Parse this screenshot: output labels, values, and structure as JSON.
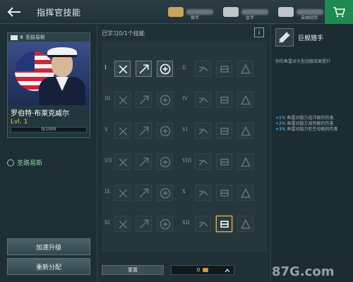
{
  "header": {
    "title": "指挥官技能",
    "currencies": [
      {
        "label": "银币",
        "color": "#c7a55a"
      },
      {
        "label": "金币",
        "color": "#c0c6c9"
      },
      {
        "label": "自由经验",
        "color": "#c0c6c9"
      }
    ]
  },
  "commander": {
    "nation_label": "圣路易斯",
    "name": "罗伯特·布莱克威尔",
    "level": "Lvl. 1",
    "xp_text": "0/1500",
    "xp_fraction": 0.0,
    "ship_name": "圣路易斯"
  },
  "left_buttons": {
    "speedup": "加速升级",
    "redistribute": "重新分配"
  },
  "skills_panel": {
    "learned_text": "已学习0/1个技能",
    "info_label": "i",
    "tiers": [
      "I",
      "II",
      "III",
      "IV",
      "V",
      "VI",
      "VII",
      "VIII",
      "IX",
      "X",
      "XI",
      "XII"
    ]
  },
  "bottom": {
    "reset_label": "重置",
    "points": "0"
  },
  "detail": {
    "title": "巨舰猎手",
    "description": "你的鱼雷对大型战舰效果提升",
    "bonuses": [
      {
        "pct": "+1%",
        "text": "鱼雷对敌方巡洋舰的伤害"
      },
      {
        "pct": "+2%",
        "text": "鱼雷对敌方战列舰的伤害"
      },
      {
        "pct": "+3%",
        "text": "鱼雷对敌方航空母舰的伤害"
      }
    ]
  },
  "watermark": "87G.com",
  "colors": {
    "accent_green": "#1e8a4f",
    "selected_gold": "#e6b430",
    "level_yellow": "#e8c546"
  }
}
